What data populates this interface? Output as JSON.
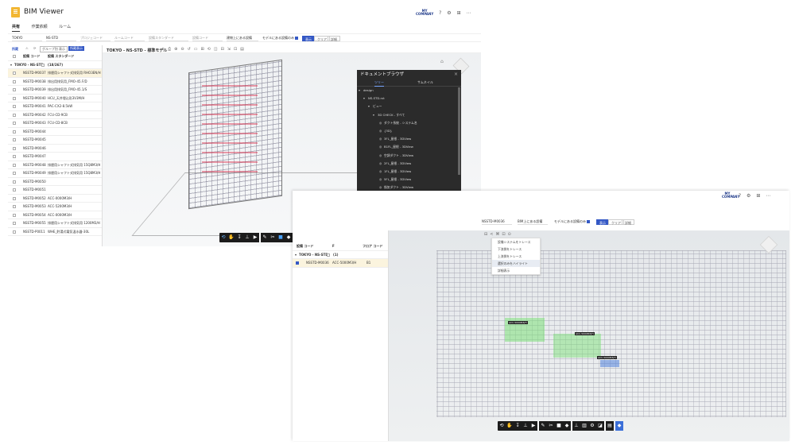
{
  "w1": {
    "app_title": "BIM Viewer",
    "tabs": [
      "共有",
      "作業依頼",
      "ルーム"
    ],
    "filters": {
      "region": "TOKYO",
      "project": "NS-STD",
      "ph1": "プロジェコード",
      "ph2": "ルームコード",
      "ph3": "設備スタンダード",
      "ph4": "設備コード",
      "mode": "建物上にある設備",
      "option": "モデルにある設備のみ",
      "apply": "表示",
      "clear": "クリア",
      "detail": "詳細"
    },
    "side": {
      "tab": "所蔵",
      "group_btn": "グループ別 表示",
      "primary_btn": "所蔵表示",
      "col1": "設備 コード",
      "col2": "設備 スタンダード",
      "group": "TOKYO - NS-STD",
      "count": "(18/267)",
      "rows": [
        [
          "NSSTD-M0037",
          "排煙用シャフト式排気用 RHO3EN/H"
        ],
        [
          "NSSTD-M0038",
          "排出用排気用_FMO-45.F/D"
        ],
        [
          "NSSTD-M0039",
          "排出用排気用_FMO-45.1/S"
        ],
        [
          "NSSTD-M0040",
          "HCU_天井埋込形3V3M/H"
        ],
        [
          "NSSTD-M0041",
          "PAC-CX2-8.5kW"
        ],
        [
          "NSSTD-M0042",
          "FCU-CD-9CB"
        ],
        [
          "NSSTD-M0043",
          "FCU-CD-8CB"
        ],
        [
          "NSSTD-M0044",
          ""
        ],
        [
          "NSSTD-M0045",
          ""
        ],
        [
          "NSSTD-M0046",
          ""
        ],
        [
          "NSSTD-M0047",
          ""
        ],
        [
          "NSSTD-M0048",
          "排煙用シャフト式排気用 15Q8M3/H"
        ],
        [
          "NSSTD-M0049",
          "排煙用シャフト式排気用 15Q8M3/H"
        ],
        [
          "NSSTD-M0050",
          ""
        ],
        [
          "NSSTD-M0051",
          ""
        ],
        [
          "NSSTD-M0052",
          "ACC-0000M3/H"
        ],
        [
          "NSSTD-M0053",
          "ACC-5200M3/H"
        ],
        [
          "NSSTD-M0054",
          "ACC-0000M3/H"
        ],
        [
          "NSSTD-M0055",
          "排煙用シャフト式排気用 1200M3/H"
        ],
        [
          "NSSTD-P0011",
          "WHE_貯湯式電気温水器-30L"
        ]
      ]
    },
    "viewer_title": "TOKYO - NS-STD - 標準モデル",
    "docs": {
      "title": "ドキュメントブラウザ",
      "tab1": "ツリー",
      "tab2": "サムネイル",
      "items": [
        "design",
        "NS-STD.rvt",
        "ビュー",
        "3D CHECK - すべて",
        "ダクト系統 - システム名",
        "{3D}",
        "3FL_屋根 - 3DView",
        "B1FL_屋根 - 3DView",
        "空調ダクト - 3DView",
        "2FL_屋根 - 3DView",
        "1FL_屋根 - 3DView",
        "5FL_屋根 - 3DView",
        "換気ダクト - 3DView",
        "消火 - 3DView",
        "空調機器 - 3DView",
        "給排水 - 3DView",
        "衛生 - 3DView",
        "衛生設備 - 3DView"
      ]
    }
  },
  "w2": {
    "company": "MY COMPANY",
    "filters": {
      "equip": "NSSTD-M0036",
      "mode": "BIM上にある設備",
      "option": "モデルにある設備のみ",
      "apply": "表示",
      "clear": "クリア",
      "detail": "詳細"
    },
    "list": {
      "col1": "設備 コード",
      "col2": "F",
      "col3": "フロア コード",
      "group": "TOKYO - NS-STD",
      "count": "(1)",
      "row": [
        "NSSTD-M0036",
        "ACC-5000M3/H",
        "B1"
      ]
    },
    "menu": [
      "設備システムをトレース",
      "下流側をトレース",
      "上流側をトレース",
      "選択のみをハイライト",
      "詳細表示"
    ],
    "tags": [
      "ACC-5000M3/H",
      "ACC-5000M3/H",
      "ACC-5000M3/H"
    ]
  },
  "colors": {
    "accent": "#3458c5",
    "logo": "#f2b632",
    "toolbar": "#1c1c1c",
    "panel": "#2b2b2b",
    "highlight": "#7ee07a"
  }
}
